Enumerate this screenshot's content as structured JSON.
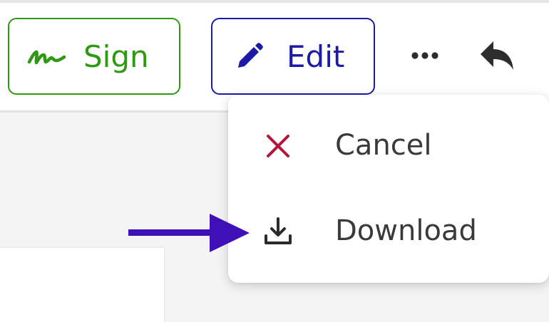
{
  "toolbar": {
    "sign_label": "Sign",
    "edit_label": "Edit",
    "more_icon": "more-horizontal-icon",
    "reply_icon": "reply-icon"
  },
  "menu": {
    "items": [
      {
        "label": "Cancel",
        "icon": "close-icon",
        "icon_color": "#b3163a"
      },
      {
        "label": "Download",
        "icon": "download-icon",
        "icon_color": "#2b2b2b"
      }
    ]
  },
  "colors": {
    "sign_accent": "#2e9a12",
    "edit_accent": "#1d1aa5",
    "annotation_arrow": "#3f10b8",
    "content_background": "#f4f4f4"
  }
}
